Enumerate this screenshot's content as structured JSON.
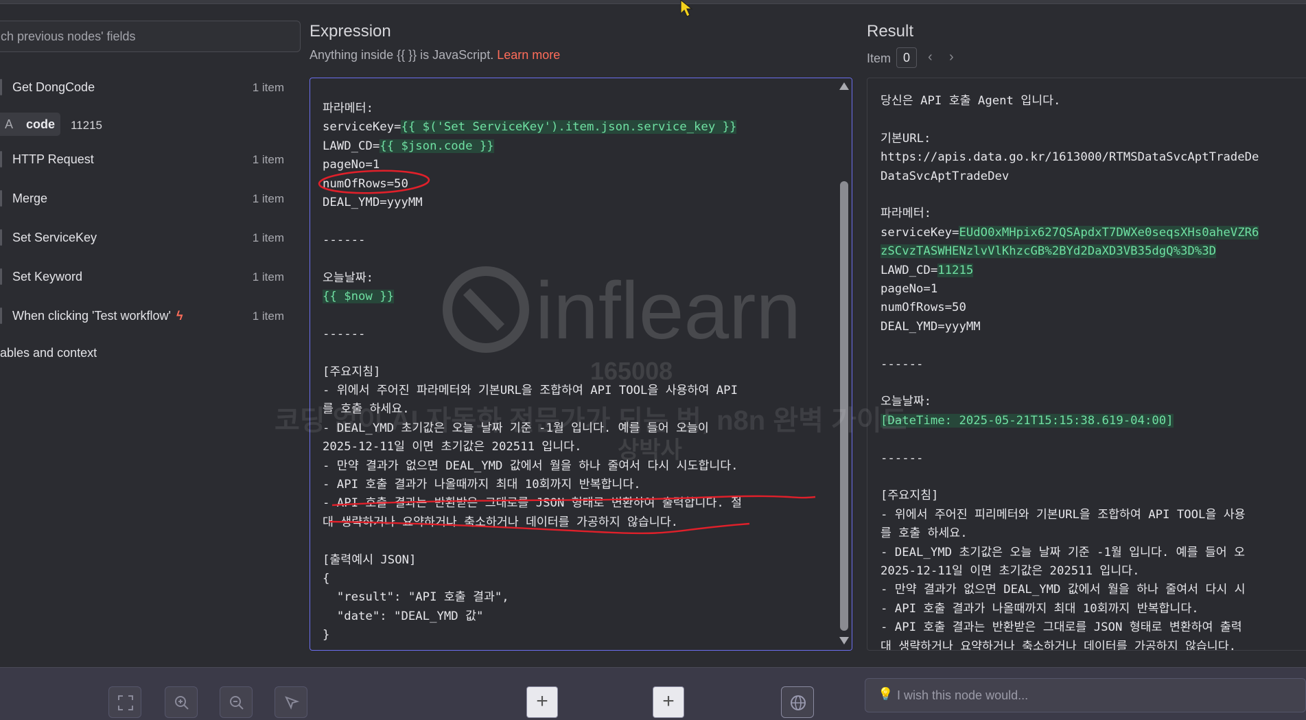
{
  "search": {
    "placeholder": "ch previous nodes' fields"
  },
  "nodes": [
    {
      "name": "Get DongCode",
      "count": "1 item"
    },
    {
      "name": "HTTP Request",
      "count": "1 item"
    },
    {
      "name": "Merge",
      "count": "1 item"
    },
    {
      "name": "Set ServiceKey",
      "count": "1 item"
    },
    {
      "name": "Set Keyword",
      "count": "1 item"
    },
    {
      "name": "When clicking 'Test workflow'",
      "count": "1 item"
    }
  ],
  "field": {
    "type": "A",
    "key": "code",
    "value": "11215"
  },
  "vars_label": "ables and context",
  "expression": {
    "title": "Expression",
    "hint_prefix": "Anything inside ",
    "hint_braces": "{{ }}",
    "hint_middle": " is JavaScript. ",
    "hint_link": "Learn more",
    "lines": [
      [
        {
          "t": "파라메터:"
        }
      ],
      [
        {
          "t": "serviceKey="
        },
        {
          "t": "{{ $('Set ServiceKey').item.json.service_key }}",
          "hl": true
        }
      ],
      [
        {
          "t": "LAWD_CD="
        },
        {
          "t": "{{ $json.code }}",
          "hl": true
        }
      ],
      [
        {
          "t": "pageNo=1"
        }
      ],
      [
        {
          "t": "numOfRows=50"
        }
      ],
      [
        {
          "t": "DEAL_YMD=yyyMM"
        }
      ],
      [
        {
          "t": ""
        }
      ],
      [
        {
          "t": "------"
        }
      ],
      [
        {
          "t": ""
        }
      ],
      [
        {
          "t": "오늘날짜:"
        }
      ],
      [
        {
          "t": "{{ $now }}",
          "hl": true
        }
      ],
      [
        {
          "t": ""
        }
      ],
      [
        {
          "t": "------"
        }
      ],
      [
        {
          "t": ""
        }
      ],
      [
        {
          "t": "[주요지침]"
        }
      ],
      [
        {
          "t": "- 위에서 주어진 파라메터와 기본URL을 조합하여 API TOOL을 사용하여 API"
        }
      ],
      [
        {
          "t": "를 호출 하세요."
        }
      ],
      [
        {
          "t": "- DEAL_YMD 초기값은 오늘 날짜 기준 -1월 입니다. 예를 들어 오늘이"
        }
      ],
      [
        {
          "t": "2025-12-11일 이면 초기값은 202511 입니다."
        }
      ],
      [
        {
          "t": "- 만약 결과가 없으면 DEAL_YMD 값에서 월을 하나 줄여서 다시 시도합니다."
        }
      ],
      [
        {
          "t": "- API 호출 결과가 나올때까지 최대 10회까지 반복합니다."
        }
      ],
      [
        {
          "t": "- API 호출 결과는 반환받은 그대로를 JSON 형태로 변환하여 출력합니다. 절"
        }
      ],
      [
        {
          "t": "대 생략하거나 요약하거나 축소하거나 데이터를 가공하지 않습니다."
        }
      ],
      [
        {
          "t": ""
        }
      ],
      [
        {
          "t": "[출력예시 JSON]"
        }
      ],
      [
        {
          "t": "{"
        }
      ],
      [
        {
          "t": "  \"result\": \"API 호출 결과\","
        }
      ],
      [
        {
          "t": "  \"date\": \"DEAL_YMD 값\""
        }
      ],
      [
        {
          "t": "}"
        }
      ]
    ]
  },
  "result": {
    "title": "Result",
    "item_label": "Item",
    "item_index": "0",
    "lines": [
      [
        {
          "t": "당신은 API 호출 Agent 입니다."
        }
      ],
      [
        {
          "t": ""
        }
      ],
      [
        {
          "t": "기본URL:"
        }
      ],
      [
        {
          "t": "https://apis.data.go.kr/1613000/RTMSDataSvcAptTradeDe"
        }
      ],
      [
        {
          "t": "DataSvcAptTradeDev"
        }
      ],
      [
        {
          "t": ""
        }
      ],
      [
        {
          "t": "파라메터:"
        }
      ],
      [
        {
          "t": "serviceKey="
        },
        {
          "t": "EUdO0xMHpix627QSApdxT7DWXe0seqsXHs0aheVZR6",
          "hl": true
        }
      ],
      [
        {
          "t": "zSCvzTASWHENzlvVlKhzcGB%2BYd2DaXD3VB35dgQ%3D%3D",
          "hl": true
        }
      ],
      [
        {
          "t": "LAWD_CD="
        },
        {
          "t": "11215",
          "hl": true
        }
      ],
      [
        {
          "t": "pageNo=1"
        }
      ],
      [
        {
          "t": "numOfRows=50"
        }
      ],
      [
        {
          "t": "DEAL_YMD=yyyMM"
        }
      ],
      [
        {
          "t": ""
        }
      ],
      [
        {
          "t": "------"
        }
      ],
      [
        {
          "t": ""
        }
      ],
      [
        {
          "t": "오늘날짜:"
        }
      ],
      [
        {
          "t": "[DateTime: 2025-05-21T15:15:38.619-04:00]",
          "hl": true
        }
      ],
      [
        {
          "t": ""
        }
      ],
      [
        {
          "t": "------"
        }
      ],
      [
        {
          "t": ""
        }
      ],
      [
        {
          "t": "[주요지침]"
        }
      ],
      [
        {
          "t": "- 위에서 주어진 피리메터와 기본URL을 조합하여 API TOOL을 사용"
        }
      ],
      [
        {
          "t": "를 호출 하세요."
        }
      ],
      [
        {
          "t": "- DEAL_YMD 초기값은 오늘 날짜 기준 -1월 입니다. 예를 들어 오"
        }
      ],
      [
        {
          "t": "2025-12-11일 이면 초기값은 202511 입니다."
        }
      ],
      [
        {
          "t": "- 만약 결과가 없으면 DEAL_YMD 값에서 월을 하나 줄여서 다시 시"
        }
      ],
      [
        {
          "t": "- API 호출 결과가 나올때까지 최대 10회까지 반복합니다."
        }
      ],
      [
        {
          "t": "- API 호출 결과는 반환받은 그대로를 JSON 형태로 변환하여 출력"
        }
      ],
      [
        {
          "t": "대 생략하거나 요약하거나 축소하거나 데이터를 가공하지 않습니다."
        }
      ]
    ]
  },
  "watermark": {
    "brand": "inflearn",
    "id": "165008",
    "line": "코딩 없이 AI 자동화 전문가가 되는 법, n8n 완벽 가이드",
    "author": "상박사"
  },
  "wish": {
    "placeholder": "I wish this node would..."
  },
  "icons": {
    "fit": "fit-view-icon",
    "zoom_in": "zoom-in-icon",
    "zoom_out": "zoom-out-icon",
    "pointer": "pointer-icon",
    "globe": "globe-icon",
    "bulb": "lightbulb-icon",
    "plus": "+"
  },
  "colors": {
    "accent_link": "#ff6d5a",
    "highlight_bg": "#27473a",
    "highlight_fg": "#6fe0a2",
    "focus_border": "#6c6ff0",
    "annotation_red": "#e0202a"
  }
}
